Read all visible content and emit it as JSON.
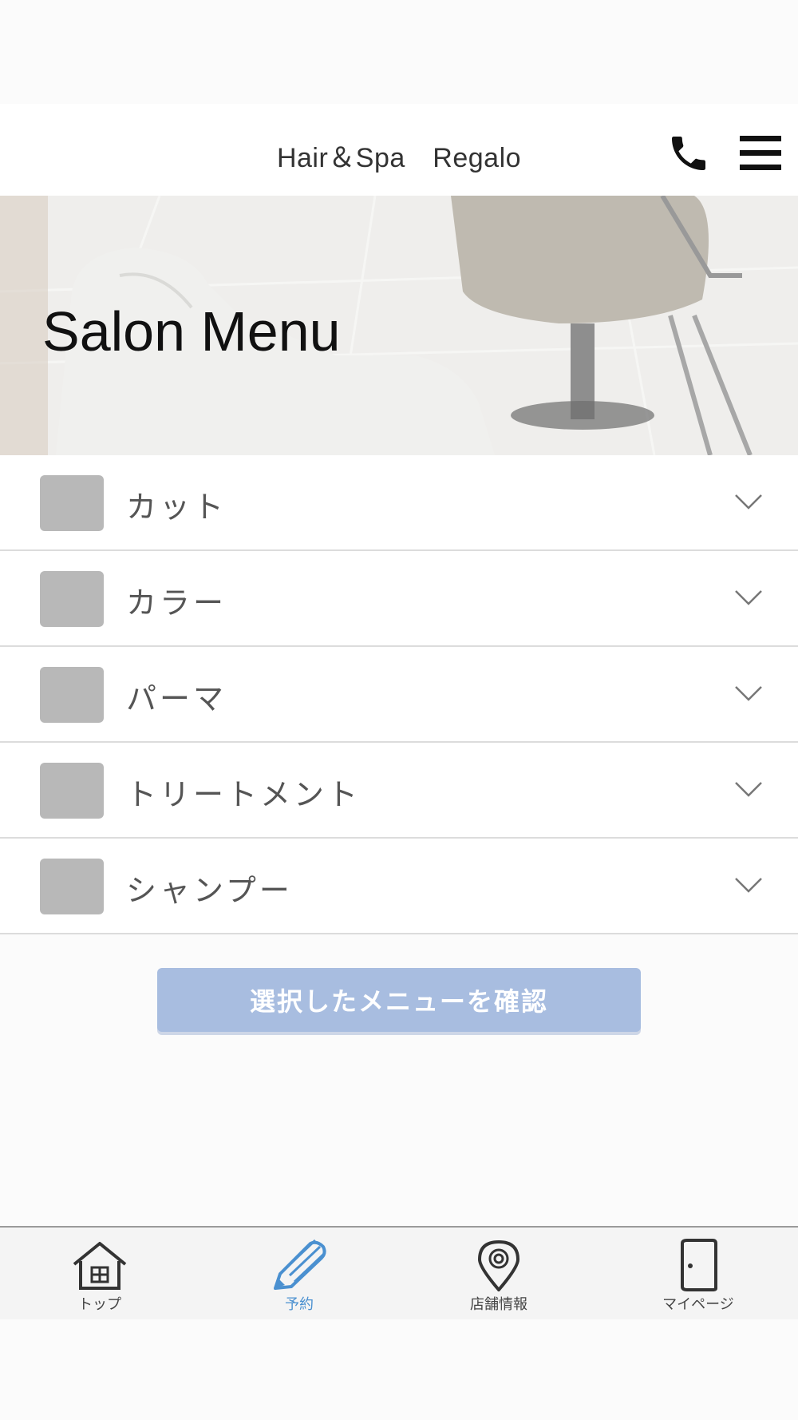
{
  "header": {
    "brand": "Hair＆Spa　Regalo",
    "phone_icon": "phone-icon",
    "menu_icon": "hamburger-menu-icon"
  },
  "hero": {
    "title": "Salon Menu"
  },
  "menu_items": [
    {
      "label": "カット",
      "checked": false
    },
    {
      "label": "カラー",
      "checked": false
    },
    {
      "label": "パーマ",
      "checked": false
    },
    {
      "label": "トリートメント",
      "checked": false
    },
    {
      "label": "シャンプー",
      "checked": false
    }
  ],
  "confirm_button": {
    "label": "選択したメニューを確認",
    "color": "#a8bde0"
  },
  "tabbar": {
    "active": "reserve",
    "accent_color": "#4a90d0",
    "tabs": [
      {
        "label": "トップ",
        "icon": "home-icon"
      },
      {
        "label": "予約",
        "icon": "pencil-icon"
      },
      {
        "label": "店舗情報",
        "icon": "location-pin-icon"
      },
      {
        "label": "マイページ",
        "icon": "door-icon"
      }
    ]
  }
}
